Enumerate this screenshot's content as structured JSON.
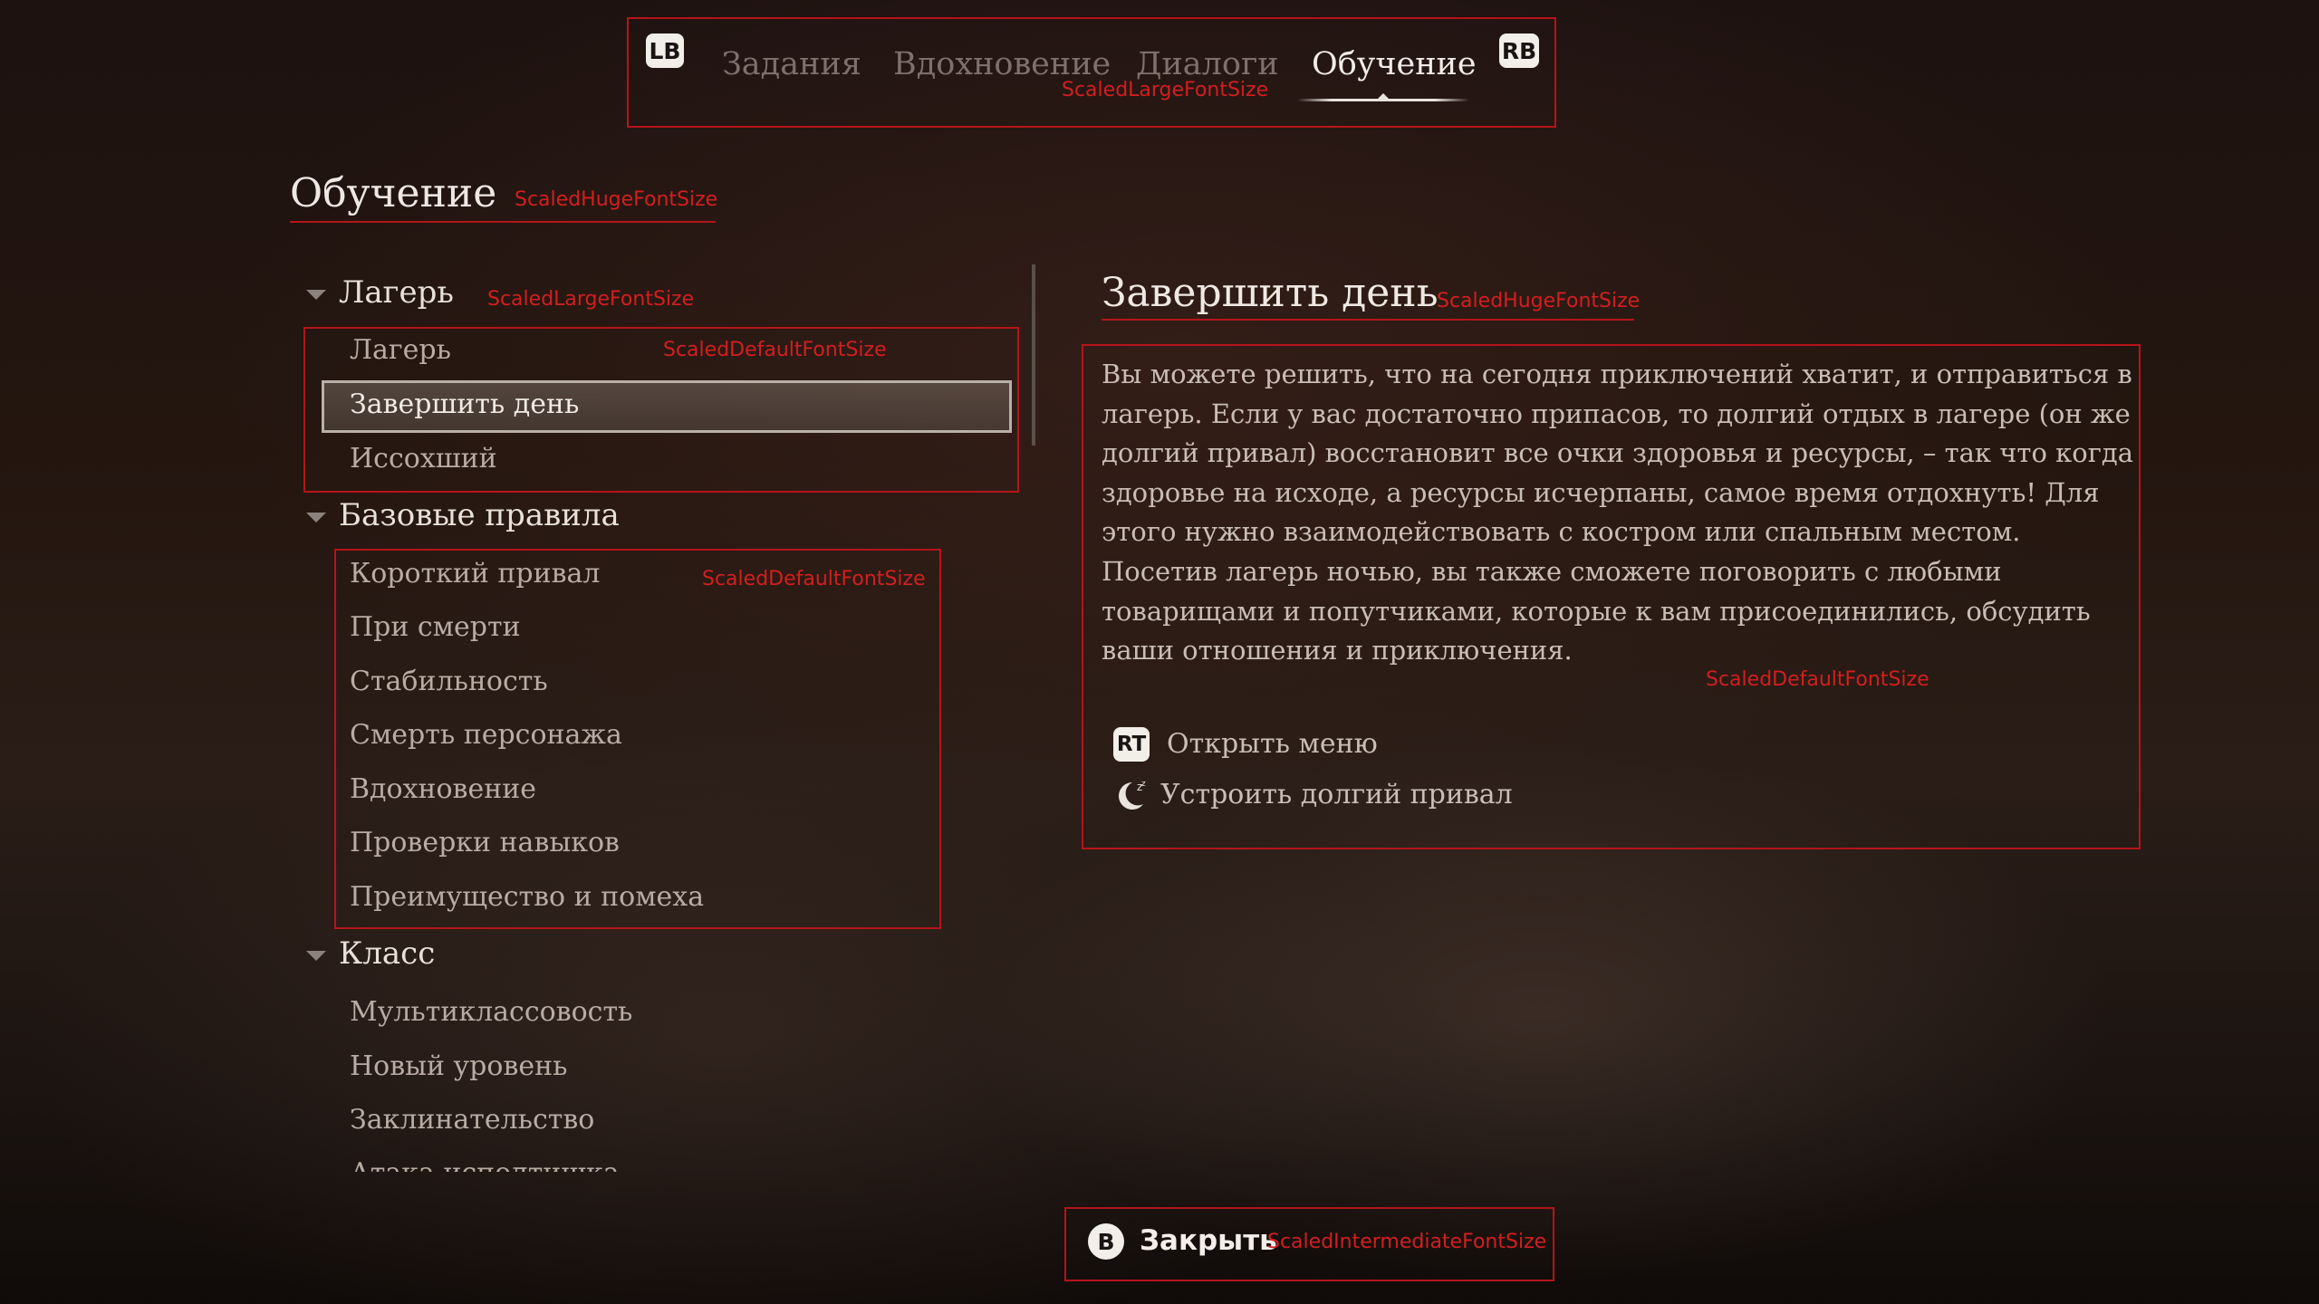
{
  "top_tabs": {
    "left_bumper": "LB",
    "right_bumper": "RB",
    "items": [
      "Задания",
      "Вдохновение",
      "Диалоги",
      "Обучение"
    ],
    "active_index": 3,
    "debug_label": "ScaledLargeFontSize"
  },
  "page": {
    "title": "Обучение",
    "title_debug": "ScaledHugeFontSize"
  },
  "sections": [
    {
      "name": "Лагерь",
      "debug_label": "ScaledLargeFontSize",
      "items_debug": "ScaledDefaultFontSize",
      "items": [
        "Лагерь",
        "Завершить день",
        "Иссохший"
      ],
      "selected_index": 1
    },
    {
      "name": "Базовые правила",
      "items_debug": "ScaledDefaultFontSize",
      "items": [
        "Короткий привал",
        "При смерти",
        "Стабильность",
        "Смерть персонажа",
        "Вдохновение",
        "Проверки навыков",
        "Преимущество и помеха"
      ]
    },
    {
      "name": "Класс",
      "items": [
        "Мультиклассовость",
        "Новый уровень",
        "Заклинательство",
        "Атака исподтишка"
      ]
    }
  ],
  "detail": {
    "title": "Завершить день",
    "title_debug": "ScaledHugeFontSize",
    "paragraph1": "Вы можете решить, что на сегодня приключений хватит, и отправиться в лагерь. Если у вас достаточно припасов, то долгий отдых в лагере (он же долгий привал) восстановит все очки здоровья и ресурсы, – так что когда здоровье на исходе, а ресурсы исчерпаны, самое время отдохнуть! Для этого нужно взаимодействовать с костром или спальным местом.",
    "paragraph2": "Посетив лагерь ночью, вы также сможете поговорить с любыми товарищами и попутчиками, которые к вам присоединились, обсудить ваши отношения и приключения.",
    "body_debug": "ScaledDefaultFontSize",
    "actions": [
      {
        "badge": "RT",
        "label": "Открыть меню",
        "icon": "rt-button-icon"
      },
      {
        "badge": "",
        "label": "Устроить долгий привал",
        "icon": "moon-sleep-icon"
      }
    ]
  },
  "footer": {
    "close_badge": "B",
    "close_label": "Закрыть",
    "close_debug": "ScaledIntermediateFontSize"
  },
  "colors": {
    "debug_red": "#d21f1f",
    "frame_red": "#b5141a",
    "text_light": "#f0e9e3",
    "text_dim": "#b8aca4"
  }
}
